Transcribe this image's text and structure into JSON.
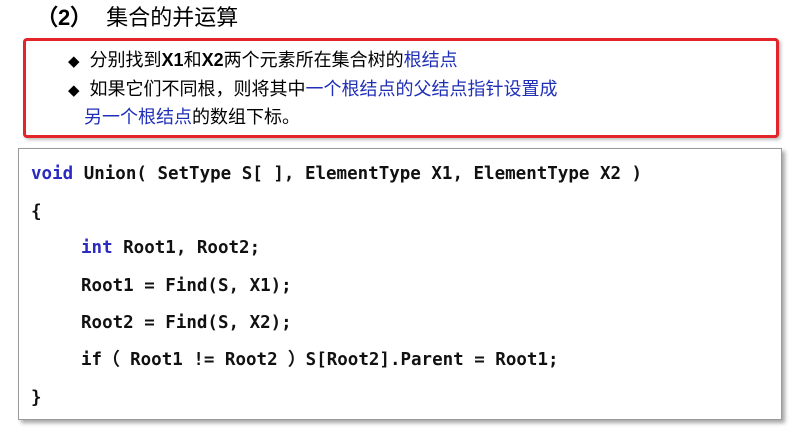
{
  "heading": {
    "number": "（2）",
    "text": "集合的并运算"
  },
  "notes": {
    "bullet_glyph": "◆",
    "line1": {
      "a": "分别找到",
      "b": "X1",
      "c": "和",
      "d": "X2",
      "e": "两个元素所在集合树的",
      "f": "根结点"
    },
    "line2": {
      "a": "如果它们不同根，则将其中",
      "b": "一个根结点的父结点指针设置成"
    },
    "line3": {
      "a": "另一个根结点",
      "b": "的数组下标。"
    },
    "highlight_color": "#1f2fb8",
    "border_color": "#e3242b"
  },
  "code": {
    "line1": {
      "kw": "void",
      "rest": " Union( SetType S[ ], ElementType X1, ElementType X2 )"
    },
    "line2": "{",
    "line3": {
      "kw": "int",
      "rest": " Root1, Root2;"
    },
    "line4": "Root1 = Find(S, X1);",
    "line5": "Root2 = Find(S, X2);",
    "line6": {
      "kw": "if",
      "rest": "（ Root1 != Root2 ）S[Root2].Parent = Root1;"
    },
    "line7": "}",
    "keyword_color": "#2b2bc0"
  }
}
